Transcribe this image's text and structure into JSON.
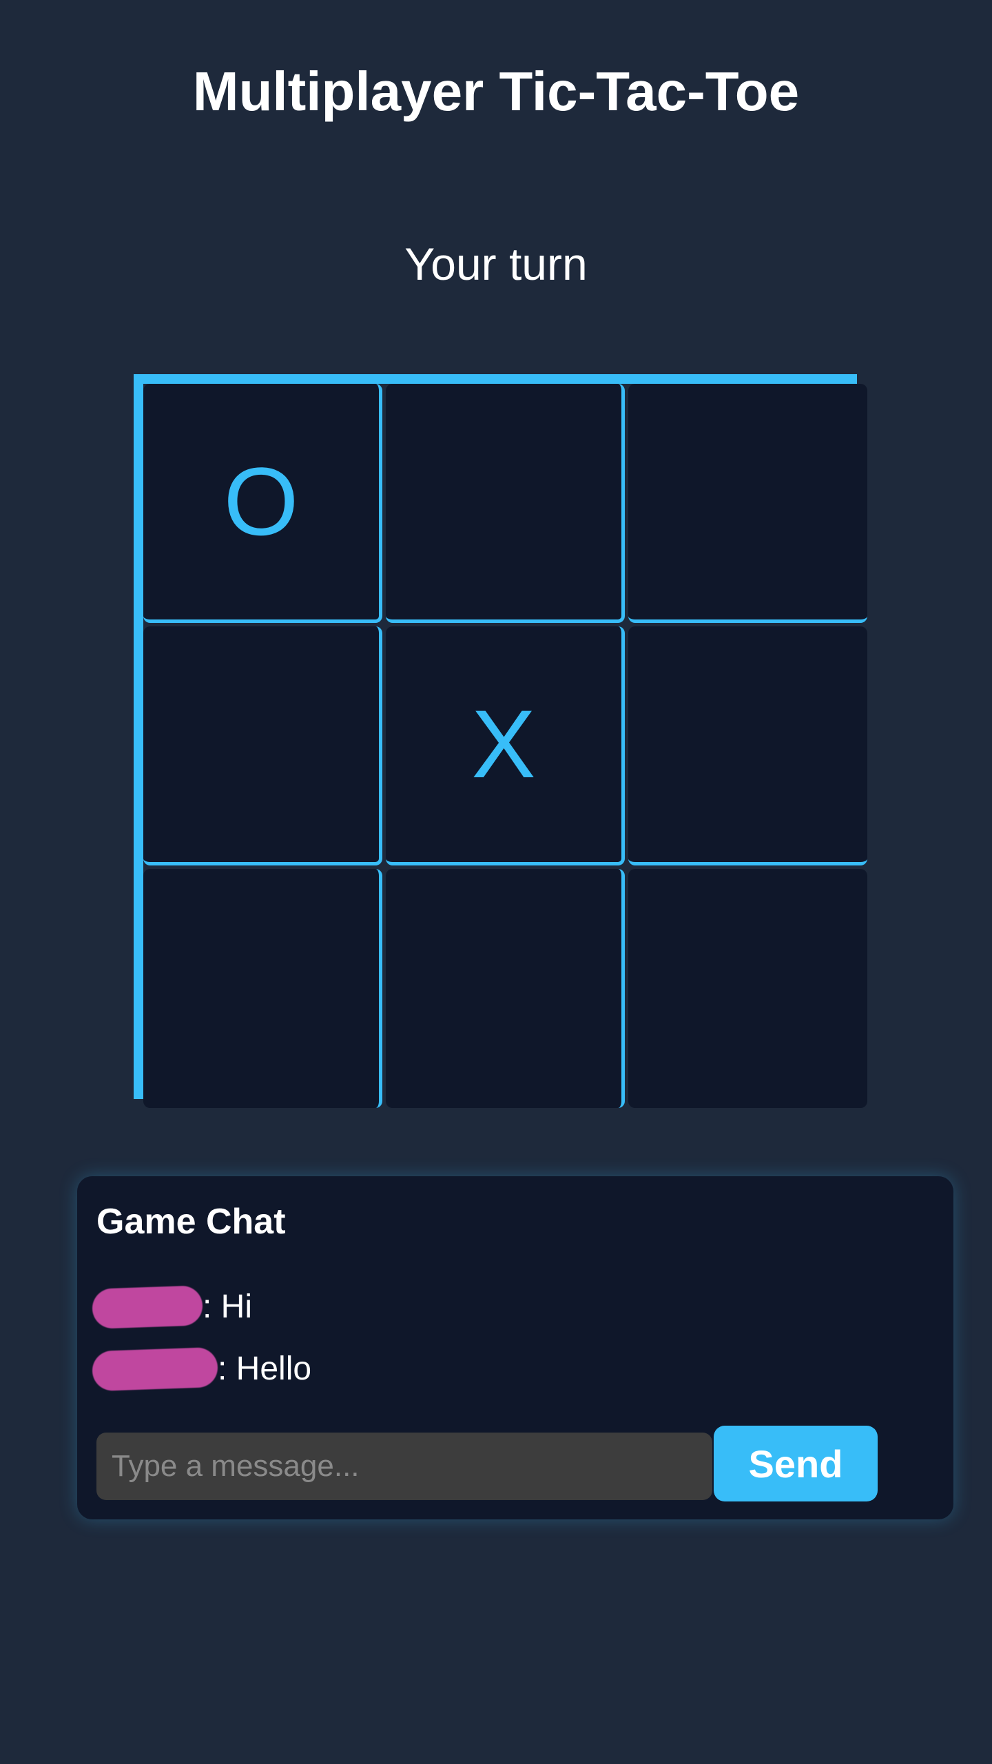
{
  "header": {
    "title": "Multiplayer Tic-Tac-Toe"
  },
  "game": {
    "status": "Your turn",
    "board": [
      [
        "O",
        "",
        ""
      ],
      [
        "",
        "X",
        ""
      ],
      [
        "",
        "",
        ""
      ]
    ]
  },
  "chat": {
    "title": "Game Chat",
    "messages": [
      {
        "text": ": Hi"
      },
      {
        "text": ": Hello"
      }
    ],
    "input_placeholder": "Type a message...",
    "input_value": "",
    "send_label": "Send"
  },
  "colors": {
    "background": "#1e293b",
    "panel": "#0f172a",
    "accent": "#38bdf8",
    "redaction": "#c0479f",
    "input_bg": "#3d3d3d"
  }
}
